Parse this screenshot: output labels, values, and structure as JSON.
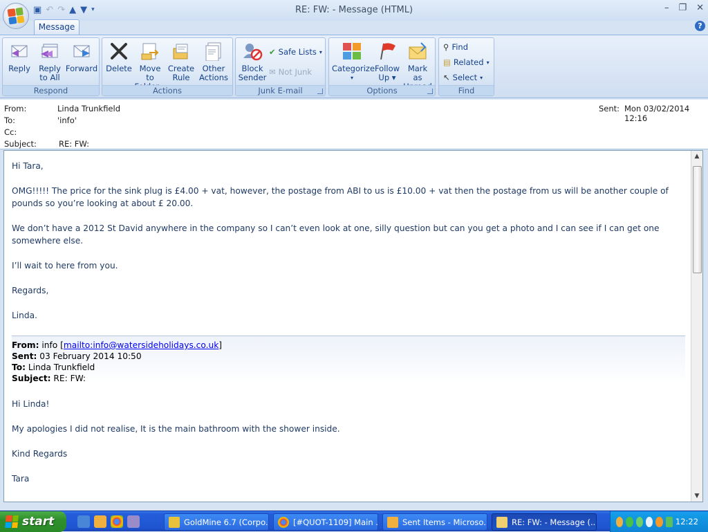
{
  "window": {
    "title": "RE: FW: - Message (HTML)"
  },
  "ribbon": {
    "tab": "Message",
    "groups": {
      "respond": "Respond",
      "actions": "Actions",
      "junk": "Junk E-mail",
      "options": "Options",
      "find": "Find"
    },
    "buttons": {
      "reply": "Reply",
      "reply_all_1": "Reply",
      "reply_all_2": "to All",
      "forward": "Forward",
      "delete": "Delete",
      "move_1": "Move to",
      "move_2": "Folder",
      "create_1": "Create",
      "create_2": "Rule",
      "other_1": "Other",
      "other_2": "Actions",
      "block_1": "Block",
      "block_2": "Sender",
      "safe_lists": "Safe Lists",
      "not_junk": "Not Junk",
      "categorize": "Categorize",
      "follow_1": "Follow",
      "follow_2": "Up",
      "mark_1": "Mark as",
      "mark_2": "Unread",
      "find": "Find",
      "related": "Related",
      "select": "Select"
    }
  },
  "header": {
    "from_label": "From:",
    "from": "Linda Trunkfield",
    "to_label": "To:",
    "to": "'info'",
    "cc_label": "Cc:",
    "cc": "",
    "subject_label": "Subject:",
    "subject": "RE: FW:",
    "sent_label": "Sent:",
    "sent": "Mon 03/02/2014 12:16"
  },
  "message": {
    "p1": "Hi Tara,",
    "p2": "OMG!!!!! The price for the sink plug is £4.00 + vat,  however, the postage from ABI to us is £10.00 + vat then the postage from us will be another couple of pounds so you’re looking at about  £ 20.00.",
    "p3": "We don’t have a 2012 St David anywhere in the company so I can’t even look at one, silly question but can you get a photo and I can see if I can get one somewhere else.",
    "p4": "I’ll wait to here from you.",
    "p5": "Regards,",
    "p6": "Linda."
  },
  "quoted": {
    "from_label": "From:",
    "from_name": "info",
    "from_link": "mailto:info@watersideholidays.co.uk",
    "sent_label": "Sent:",
    "sent": "03 February 2014 10:50",
    "to_label": "To:",
    "to": "Linda Trunkfield",
    "subject_label": "Subject:",
    "subject": "RE: FW:",
    "p1": "Hi Linda!",
    "p2": "My apologies I did not realise, It is the main bathroom with the shower inside.",
    "p3": "Kind Regards",
    "p4": "Tara"
  },
  "taskbar": {
    "start": "start",
    "tasks": [
      "GoldMine 6.7 (Corpo...",
      "[#QUOT-1109] Main ...",
      "Sent Items - Microso...",
      "RE: FW: - Message (..."
    ],
    "clock": "12:22"
  },
  "colors": {
    "accent": "#15428b",
    "taskbar": "#245edb",
    "start": "#2f8f2c"
  }
}
